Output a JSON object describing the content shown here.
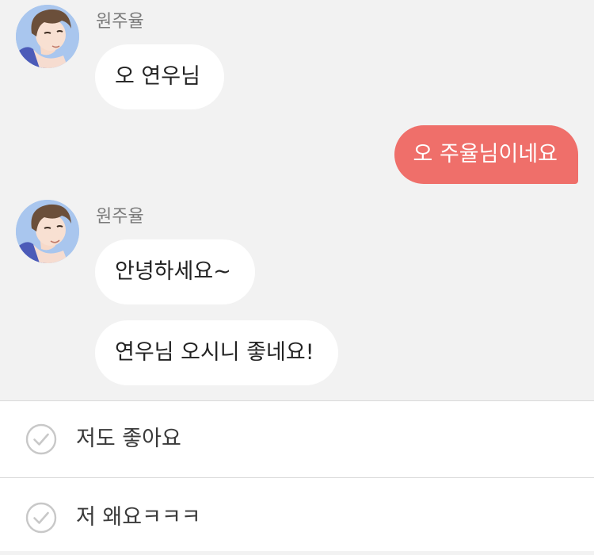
{
  "conversation": {
    "messages": [
      {
        "sender": "원주율",
        "text": "오 연우님"
      },
      {
        "sender": "me",
        "text": "오 주율님이네요"
      },
      {
        "sender": "원주율",
        "text": "안녕하세요~"
      },
      {
        "sender": "원주율",
        "text": "연우님 오시니 좋네요!"
      }
    ],
    "contact_name": "원주율",
    "avatar_icon": "character-portrait-icon"
  },
  "reply_options": [
    {
      "label": "저도 좋아요",
      "icon": "check-circle-icon"
    },
    {
      "label": "저 왜요ㅋㅋㅋ",
      "icon": "check-circle-icon"
    }
  ],
  "colors": {
    "background": "#f2f2f2",
    "incoming_bubble": "#ffffff",
    "outgoing_bubble": "#ef6f6a",
    "avatar_bg": "#a9c6ee"
  }
}
